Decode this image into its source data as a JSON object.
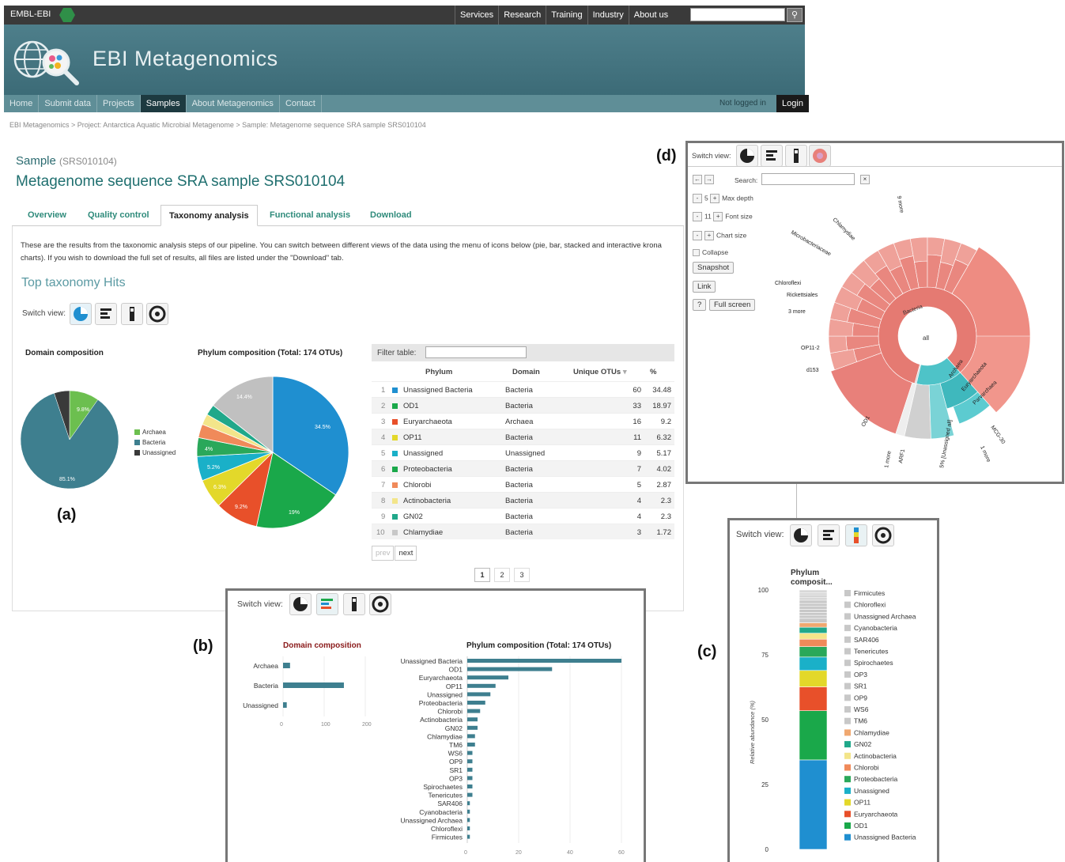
{
  "topbar": {
    "brand": "EMBL-EBI",
    "links": [
      "Services",
      "Research",
      "Training",
      "Industry",
      "About us"
    ]
  },
  "banner": {
    "title": "EBI Metagenomics"
  },
  "nav": {
    "items": [
      "Home",
      "Submit data",
      "Projects",
      "Samples",
      "About Metagenomics",
      "Contact"
    ],
    "active": "Samples",
    "not_logged": "Not logged in",
    "login": "Login"
  },
  "breadcrumb": "EBI Metagenomics > Project: Antarctica Aquatic Microbial Metagenome > Sample: Metagenome sequence SRA sample SRS010104",
  "sample": {
    "label": "Sample",
    "id": "(SRS010104)",
    "title": "Metagenome sequence SRA sample SRS010104"
  },
  "tabs": [
    "Overview",
    "Quality control",
    "Taxonomy analysis",
    "Functional analysis",
    "Download"
  ],
  "description": "These are the results from the taxonomic analysis steps of our pipeline. You can switch between different views of the data using the menu of icons below (pie, bar, stacked and interactive krona charts). If you wish to download the full set of results, all files are listed under the \"Download\" tab.",
  "section_title": "Top taxonomy Hits",
  "switch_view": "Switch view:",
  "panel_letters": {
    "a": "(a)",
    "b": "(b)",
    "c": "(c)",
    "d": "(d)"
  },
  "colors": {
    "bacteria": "#3e7f8f",
    "archaea": "#6cbf4f",
    "unassigned": "#3a3a3a",
    "accent": "#2f8b7b"
  },
  "domain_pie": {
    "title": "Domain composition",
    "labels": {
      "archaea": "9.8%",
      "bacteria": "85.1%"
    },
    "legend": [
      "Archaea",
      "Bacteria",
      "Unassigned"
    ]
  },
  "phylum_pie": {
    "title": "Phylum composition (Total: 174 OTUs)",
    "labels": [
      "34.5%",
      "19%",
      "9.2%",
      "6.3%",
      "5.2%",
      "4%",
      "14.4%"
    ]
  },
  "table": {
    "filter_label": "Filter table:",
    "headers": [
      "Phylum",
      "Domain",
      "Unique OTUs",
      "%"
    ],
    "rows": [
      {
        "n": "1",
        "phylum": "Unassigned Bacteria",
        "domain": "Bacteria",
        "otus": "60",
        "pct": "34.48",
        "color": "#1f8fd0"
      },
      {
        "n": "2",
        "phylum": "OD1",
        "domain": "Bacteria",
        "otus": "33",
        "pct": "18.97",
        "color": "#1aa84a"
      },
      {
        "n": "3",
        "phylum": "Euryarchaeota",
        "domain": "Archaea",
        "otus": "16",
        "pct": "9.2",
        "color": "#e8502a"
      },
      {
        "n": "4",
        "phylum": "OP11",
        "domain": "Bacteria",
        "otus": "11",
        "pct": "6.32",
        "color": "#e3d82a"
      },
      {
        "n": "5",
        "phylum": "Unassigned",
        "domain": "Unassigned",
        "otus": "9",
        "pct": "5.17",
        "color": "#1ab0c8"
      },
      {
        "n": "6",
        "phylum": "Proteobacteria",
        "domain": "Bacteria",
        "otus": "7",
        "pct": "4.02",
        "color": "#1aa84a"
      },
      {
        "n": "7",
        "phylum": "Chlorobi",
        "domain": "Bacteria",
        "otus": "5",
        "pct": "2.87",
        "color": "#f08a5a"
      },
      {
        "n": "8",
        "phylum": "Actinobacteria",
        "domain": "Bacteria",
        "otus": "4",
        "pct": "2.3",
        "color": "#f3e58a"
      },
      {
        "n": "9",
        "phylum": "GN02",
        "domain": "Bacteria",
        "otus": "4",
        "pct": "2.3",
        "color": "#20a88a"
      },
      {
        "n": "10",
        "phylum": "Chlamydiae",
        "domain": "Bacteria",
        "otus": "3",
        "pct": "1.72",
        "color": "#c8c8c8"
      }
    ],
    "prev": "prev",
    "next": "next",
    "pages": [
      "1",
      "2",
      "3"
    ]
  },
  "bar_view": {
    "domain_title": "Domain composition",
    "domain_categories": [
      "Archaea",
      "Bacteria",
      "Unassigned"
    ],
    "domain_ticks": [
      "0",
      "100",
      "200"
    ],
    "phylum_title": "Phylum composition (Total: 174 OTUs)",
    "phylum_categories": [
      "Unassigned Bacteria",
      "OD1",
      "Euryarchaeota",
      "OP11",
      "Unassigned",
      "Proteobacteria",
      "Chlorobi",
      "Actinobacteria",
      "GN02",
      "Chlamydiae",
      "TM6",
      "WS6",
      "OP9",
      "SR1",
      "OP3",
      "Spirochaetes",
      "Tenericutes",
      "SAR406",
      "Cyanobacteria",
      "Unassigned Archaea",
      "Chloroflexi",
      "Firmicutes"
    ],
    "phylum_ticks": [
      "0",
      "20",
      "40",
      "60"
    ]
  },
  "stacked_view": {
    "title": "Phylum composit...",
    "ylabel": "Relative abundance (%)",
    "ticks": [
      "100",
      "75",
      "50",
      "25",
      "0"
    ],
    "legend": [
      "Firmicutes",
      "Chloroflexi",
      "Unassigned Archaea",
      "Cyanobacteria",
      "SAR406",
      "Tenericutes",
      "Spirochaetes",
      "OP3",
      "SR1",
      "OP9",
      "WS6",
      "TM6",
      "Chlamydiae",
      "GN02",
      "Actinobacteria",
      "Chlorobi",
      "Proteobacteria",
      "Unassigned",
      "OP11",
      "Euryarchaeota",
      "OD1",
      "Unassigned Bacteria"
    ]
  },
  "krona": {
    "search_label": "Search:",
    "max_depth": "Max depth",
    "max_depth_value": "5",
    "font_size": "Font size",
    "font_size_value": "11",
    "chart_size": "Chart size",
    "collapse": "Collapse",
    "snapshot": "Snapshot",
    "link": "Link",
    "help": "?",
    "fullscreen": "Full screen",
    "center": "all",
    "labels": [
      "Bacteria",
      "Archaea",
      "Euryarchaeota",
      "Parvarchaea",
      "MCG-30",
      "OD1",
      "Chlorobi",
      "Chloroflexi",
      "OP11",
      "9 more",
      "3 more",
      "Rickettsiales",
      "OP11-2",
      "d153",
      "ARF1",
      "5% [Unassigned all]",
      "1 more",
      "Microbacteriaceae",
      "Chlamydiae",
      "TM6"
    ]
  },
  "chart_data": [
    {
      "type": "pie",
      "title": "Domain composition",
      "categories": [
        "Archaea",
        "Bacteria",
        "Unassigned"
      ],
      "values": [
        9.8,
        85.1,
        5.1
      ]
    },
    {
      "type": "pie",
      "title": "Phylum composition (Total: 174 OTUs)",
      "categories": [
        "Unassigned Bacteria",
        "OD1",
        "Euryarchaeota",
        "OP11",
        "Unassigned",
        "Proteobacteria",
        "Chlorobi",
        "Actinobacteria",
        "GN02",
        "Other"
      ],
      "values": [
        34.5,
        19,
        9.2,
        6.3,
        5.2,
        4,
        2.9,
        2.3,
        2.3,
        14.4
      ]
    },
    {
      "type": "bar",
      "title": "Domain composition",
      "categories": [
        "Archaea",
        "Bacteria",
        "Unassigned"
      ],
      "values": [
        17,
        148,
        9
      ],
      "xlim": [
        0,
        200
      ]
    },
    {
      "type": "bar",
      "title": "Phylum composition (Total: 174 OTUs)",
      "categories": [
        "Unassigned Bacteria",
        "OD1",
        "Euryarchaeota",
        "OP11",
        "Unassigned",
        "Proteobacteria",
        "Chlorobi",
        "Actinobacteria",
        "GN02",
        "Chlamydiae",
        "TM6",
        "WS6",
        "OP9",
        "SR1",
        "OP3",
        "Spirochaetes",
        "Tenericutes",
        "SAR406",
        "Cyanobacteria",
        "Unassigned Archaea",
        "Chloroflexi",
        "Firmicutes"
      ],
      "values": [
        60,
        33,
        16,
        11,
        9,
        7,
        5,
        4,
        4,
        3,
        3,
        2,
        2,
        2,
        2,
        2,
        2,
        1,
        1,
        1,
        1,
        1
      ],
      "xlim": [
        0,
        60
      ]
    },
    {
      "type": "bar",
      "title": "Phylum composit...",
      "ylabel": "Relative abundance (%)",
      "ylim": [
        0,
        100
      ],
      "categories": [
        "Unassigned Bacteria",
        "OD1",
        "Euryarchaeota",
        "OP11",
        "Unassigned",
        "Proteobacteria",
        "Chlorobi",
        "Actinobacteria",
        "GN02",
        "Chlamydiae",
        "TM6",
        "WS6",
        "OP9",
        "SR1",
        "OP3",
        "Spirochaetes",
        "Tenericutes",
        "SAR406",
        "Cyanobacteria",
        "Unassigned Archaea",
        "Chloroflexi",
        "Firmicutes"
      ],
      "values": [
        34.48,
        18.97,
        9.2,
        6.32,
        5.17,
        4.02,
        2.87,
        2.3,
        2.3,
        1.72,
        1.72,
        1.15,
        1.15,
        1.15,
        1.15,
        1.15,
        1.15,
        0.57,
        0.57,
        0.57,
        0.57,
        0.57
      ]
    }
  ]
}
